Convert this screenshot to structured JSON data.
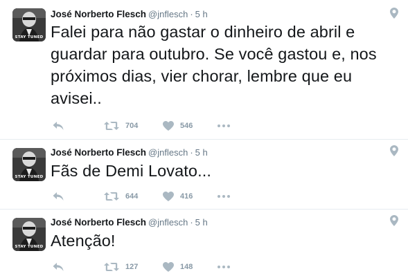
{
  "colors": {
    "text": "#14171a",
    "secondary": "#657786",
    "icon": "#aab8c2",
    "count": "#8899a6",
    "divider": "#e6ecf0"
  },
  "icons": {
    "reply": "reply-icon",
    "retweet": "retweet-icon",
    "like": "heart-icon",
    "more": "more-dots-icon",
    "location": "location-pin-icon"
  },
  "tweets": [
    {
      "author_name": "José Norberto Flesch",
      "handle": "@jnflesch",
      "separator": "·",
      "time": "5 h",
      "avatar_caption": "STAY TUNED",
      "text": "Falei para não gastar o dinheiro de abril e guardar para outubro. Se você gastou e, nos próximos dias, vier chorar, lembre que eu avisei..",
      "retweets": "704",
      "likes": "546"
    },
    {
      "author_name": "José Norberto Flesch",
      "handle": "@jnflesch",
      "separator": "·",
      "time": "5 h",
      "avatar_caption": "STAY TUNED",
      "text": "Fãs de Demi Lovato...",
      "retweets": "644",
      "likes": "416"
    },
    {
      "author_name": "José Norberto Flesch",
      "handle": "@jnflesch",
      "separator": "·",
      "time": "5 h",
      "avatar_caption": "STAY TUNED",
      "text": "Atenção!",
      "retweets": "127",
      "likes": "148"
    }
  ]
}
